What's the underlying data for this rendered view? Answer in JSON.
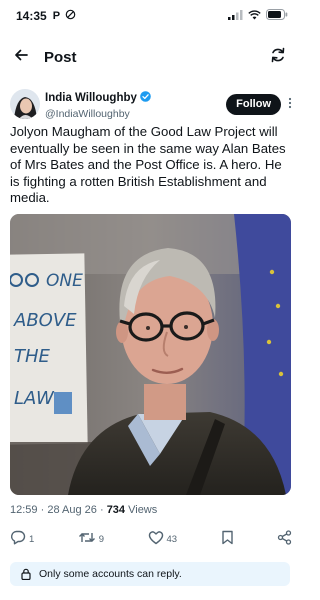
{
  "status_bar": {
    "time": "14:35",
    "carrier_letter": "P"
  },
  "nav": {
    "title": "Post"
  },
  "author": {
    "name": "India Willoughby",
    "handle": "@IndiaWilloughby",
    "verified_color": "#1d9bf0"
  },
  "follow_label": "Follow",
  "tweet": {
    "text": "Jolyon Maugham of the Good Law Project will eventually be seen in the same way Alan Bates of Mrs Bates and the Post Office is. A hero. He is fighting a rotten British Establishment and media."
  },
  "photo": {
    "placard_lines": [
      "ONE",
      "ABOVE",
      "THE",
      "LAW"
    ]
  },
  "meta": {
    "time": "12:59",
    "sep": "·",
    "date": "28 Aug 26",
    "views_count": "734",
    "views_label": "Views"
  },
  "actions": {
    "replies": "1",
    "reposts": "9",
    "likes": "43"
  },
  "reply_notice": {
    "text": "Only some accounts can reply."
  },
  "colors": {
    "accent": "#1d9bf0",
    "text": "#0f1419",
    "muted": "#536471",
    "notice_bg": "#eaf5fd"
  },
  "icons": [
    "back-arrow-icon",
    "refresh-icon",
    "verified-badge-icon",
    "more-icon",
    "reply-icon",
    "repost-icon",
    "like-icon",
    "bookmark-icon",
    "share-icon",
    "lock-icon",
    "signal-icon",
    "wifi-icon",
    "battery-icon"
  ]
}
